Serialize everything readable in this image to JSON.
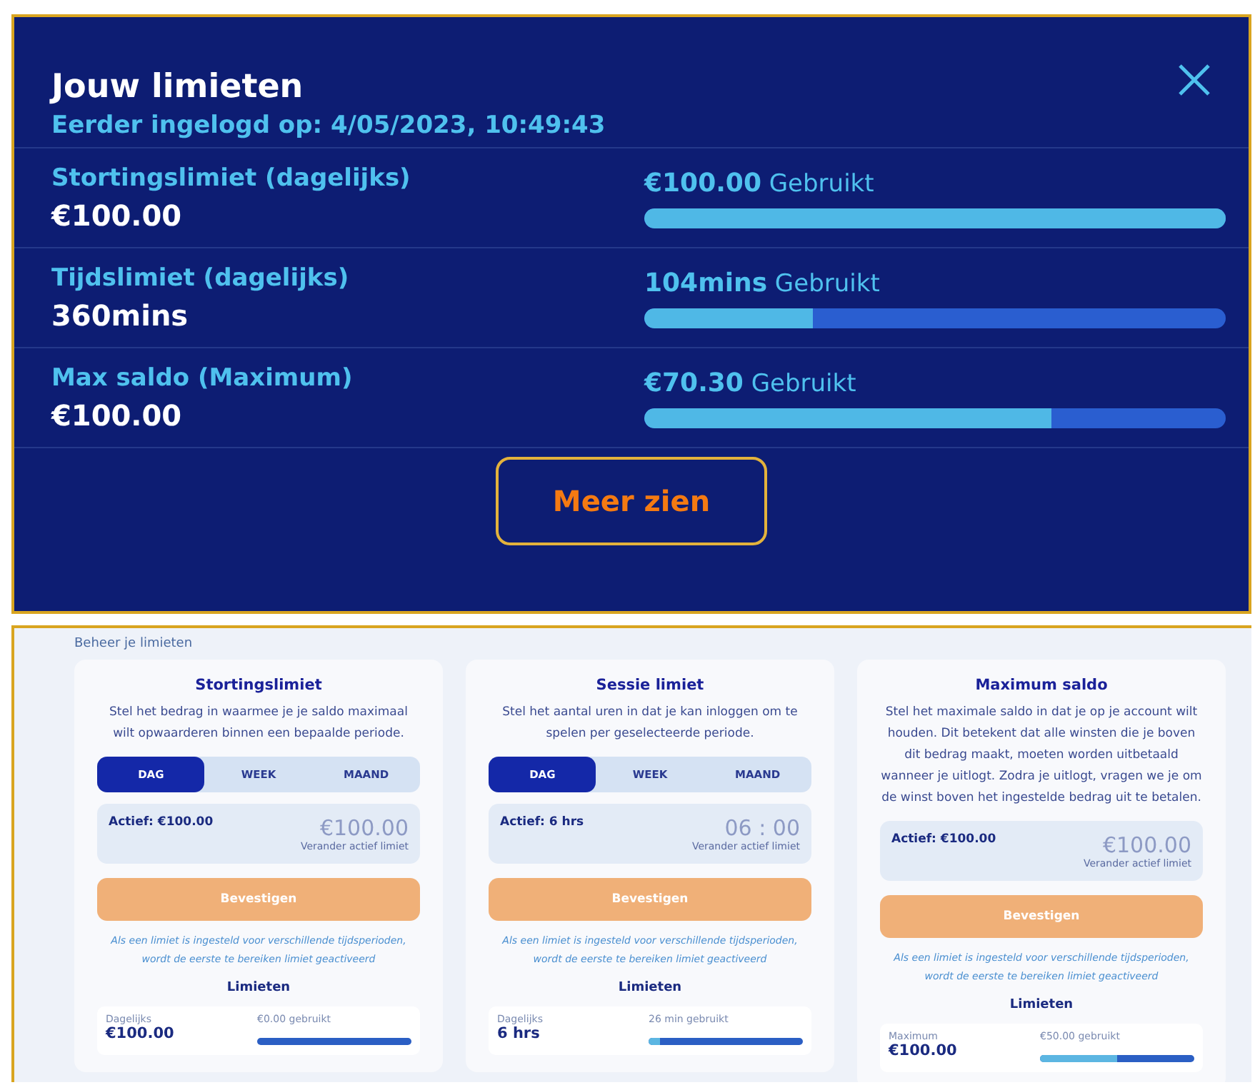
{
  "header": {
    "title": "Jouw limieten",
    "subtitle": "Eerder ingelogd op: 4/05/2023, 10:49:43"
  },
  "limits": [
    {
      "name": "Stortingslimiet (dagelijks)",
      "value": "€100.00",
      "used_amount": "€100.00",
      "used_label": "Gebruikt",
      "level": 1.0
    },
    {
      "name": "Tijdslimiet (dagelijks)",
      "value": "360mins",
      "used_amount": "104mins",
      "used_label": "Gebruikt",
      "level": 0.29
    },
    {
      "name": "Max saldo (Maximum)",
      "value": "€100.00",
      "used_amount": "€70.30",
      "used_label": "Gebruikt",
      "level": 0.7
    }
  ],
  "more_button": "Meer zien",
  "manage": {
    "heading": "Beheer je limieten",
    "cards": [
      {
        "title": "Stortingslimiet",
        "description": "Stel het bedrag in waarmee je je saldo maximaal wilt opwaarderen binnen een bepaalde periode.",
        "tabs": [
          {
            "label": "DAG",
            "selected": true
          },
          {
            "label": "WEEK",
            "selected": false
          },
          {
            "label": "MAAND",
            "selected": false
          }
        ],
        "active": "Actief: €100.00",
        "amount": "€100.00",
        "change_label": "Verander actief limiet",
        "confirm": "Bevestigen",
        "note": "Als een limiet is ingesteld voor verschillende tijdsperioden, wordt de eerste te bereiken limiet geactiveerd",
        "limits_heading": "Limieten",
        "usage_period": "Dagelijks",
        "usage_value": "€100.00",
        "usage_text": "€0.00 gebruikt",
        "level": 0.0
      },
      {
        "title": "Sessie limiet",
        "description": "Stel het aantal uren in dat je kan inloggen om te spelen per geselecteerde periode.",
        "tabs": [
          {
            "label": "DAG",
            "selected": true
          },
          {
            "label": "WEEK",
            "selected": false
          },
          {
            "label": "MAAND",
            "selected": false
          }
        ],
        "active": "Actief: 6 hrs",
        "amount": "06 : 00",
        "change_label": "Verander actief limiet",
        "confirm": "Bevestigen",
        "note": "Als een limiet is ingesteld voor verschillende tijdsperioden, wordt de eerste te bereiken limiet geactiveerd",
        "limits_heading": "Limieten",
        "usage_period": "Dagelijks",
        "usage_value": "6 hrs",
        "usage_text": "26 min gebruikt",
        "level": 0.07
      },
      {
        "title": "Maximum saldo",
        "description": "Stel het maximale saldo in dat je op je account wilt houden. Dit betekent dat alle winsten die je boven dit bedrag maakt, moeten worden uitbetaald wanneer je uitlogt. Zodra je uitlogt, vragen we je om de winst boven het ingestelde bedrag uit te betalen.",
        "active": "Actief: €100.00",
        "amount": "€100.00",
        "change_label": "Verander actief limiet",
        "confirm": "Bevestigen",
        "note": "Als een limiet is ingesteld voor verschillende tijdsperioden, wordt de eerste te bereiken limiet geactiveerd",
        "limits_heading": "Limieten",
        "usage_period": "Maximum",
        "usage_value": "€100.00",
        "usage_text": "€50.00 gebruikt",
        "level": 0.5
      }
    ]
  }
}
